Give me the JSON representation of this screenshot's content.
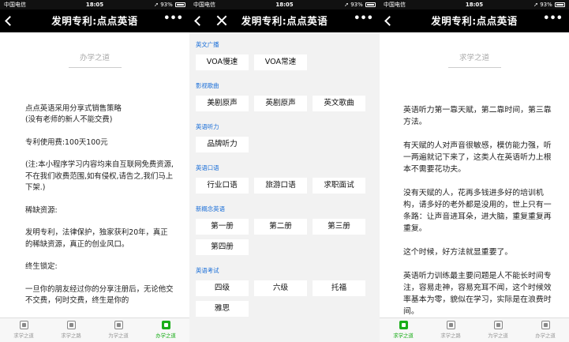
{
  "status": {
    "carrier": "中国电信",
    "time": "18:05",
    "battery": "93%"
  },
  "panel1": {
    "nav_title": "发明专利:点点英语",
    "section_title": "办学之道",
    "paragraphs": [
      "点点英语采用分享式销售策略\n(没有老师的新人不能交费)",
      "专利使用费:100天100元",
      "(注:本小程序学习内容均来自互联网免费资源,不在我们收费范围,如有侵权,请告之,我们马上下架.)",
      "稀缺资源:",
      "发明专利，法律保护，独家获利20年，真正的稀缺资源，真正的创业风口。",
      "终生锁定:",
      "一旦你的朋友经过你的分享注册后，无论他交不交费，何时交费，终生是你的"
    ],
    "tabs": [
      {
        "label": "求学之道",
        "active": false
      },
      {
        "label": "求学之路",
        "active": false
      },
      {
        "label": "为学之道",
        "active": false
      },
      {
        "label": "办学之道",
        "active": true
      }
    ]
  },
  "panel2": {
    "nav_title": "发明专利:点点英语",
    "categories": [
      {
        "title": "英文广播",
        "items": [
          "VOA慢速",
          "VOA常速"
        ]
      },
      {
        "title": "影视歌曲",
        "items": [
          "美剧原声",
          "英剧原声",
          "英文歌曲"
        ]
      },
      {
        "title": "英语听力",
        "items": [
          "品牌听力"
        ]
      },
      {
        "title": "英语口语",
        "items": [
          "行业口语",
          "旅游口语",
          "求职面试"
        ]
      },
      {
        "title": "新概念英语",
        "items": [
          "第一册",
          "第二册",
          "第三册",
          "第四册"
        ]
      },
      {
        "title": "英语考试",
        "items": [
          "四级",
          "六级",
          "托福",
          "雅思"
        ]
      }
    ]
  },
  "panel3": {
    "nav_title": "发明专利:点点英语",
    "section_title": "求学之道",
    "paragraphs": [
      "英语听力第一靠天赋，第二靠时间，第三靠方法。",
      "有天赋的人对声音很敏感，模仿能力强，听一两遍就记下来了，这类人在英语听力上根本不需要花功夫。",
      "没有天赋的人，花再多钱进多好的培训机构，请多好的老外都是没用的，世上只有一条路：让声音进耳朵，进大脑，重复重复再重复。",
      "这个时候，好方法就显重要了。",
      "英语听力训练最主要问题是人不能长时间专注，容易走神，容易充耳不闻，这个时候效率基本为零，貌似在学习，实际是在浪费时间。"
    ],
    "tabs": [
      {
        "label": "求学之道",
        "active": true
      },
      {
        "label": "求学之路",
        "active": false
      },
      {
        "label": "为学之道",
        "active": false
      },
      {
        "label": "办学之道",
        "active": false
      }
    ]
  }
}
